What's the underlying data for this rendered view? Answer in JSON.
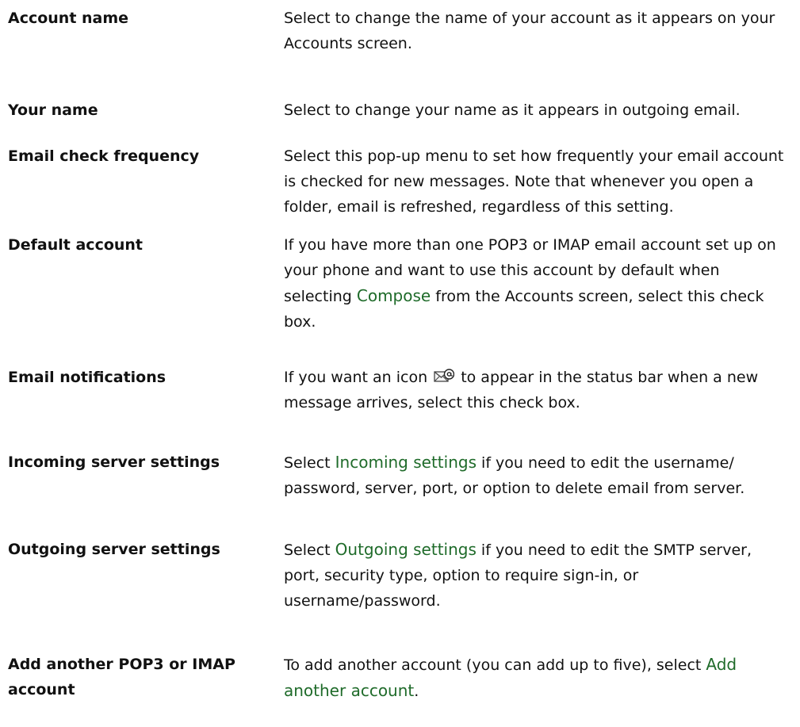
{
  "rows": [
    {
      "term": "Account name",
      "desc": "Select to change the name of your account as it appears on your Accounts screen."
    },
    {
      "term": "Your name",
      "desc": "Select to change your name as it appears in outgoing email."
    },
    {
      "term": "Email check frequency",
      "desc": "Select this pop-up menu to set how frequently your email account is checked for new messages. Note that whenever you open a folder, email is refreshed, regardless of this setting."
    },
    {
      "term": "Default account",
      "desc_before": "If you have more than one POP3 or IMAP email account set up on your phone and want to use this account by default when selecting ",
      "desc_ui": "Compose",
      "desc_after": " from the Accounts screen, select this check box."
    },
    {
      "term": "Email notifications",
      "desc_before": "If you want an icon ",
      "desc_icon": "email-notification-icon",
      "desc_after": " to appear in the status bar when a new message arrives, select this check box."
    },
    {
      "term": "Incoming server settings",
      "desc_before": "Select ",
      "desc_ui": "Incoming settings",
      "desc_after": " if you need to edit the username/ password, server, port, or option to delete email from server."
    },
    {
      "term": "Outgoing server settings",
      "desc_before": "Select ",
      "desc_ui": "Outgoing settings",
      "desc_after": " if you need to edit the SMTP server, port, security type, option to require sign-in, or username/password."
    },
    {
      "term": "Add another POP3 or IMAP account",
      "desc_before": "To add another account (you can add up to five), select ",
      "desc_ui": "Add another account",
      "desc_after": "."
    }
  ],
  "colors": {
    "ui_text": "#1f6b2a",
    "body_text": "#111111"
  }
}
